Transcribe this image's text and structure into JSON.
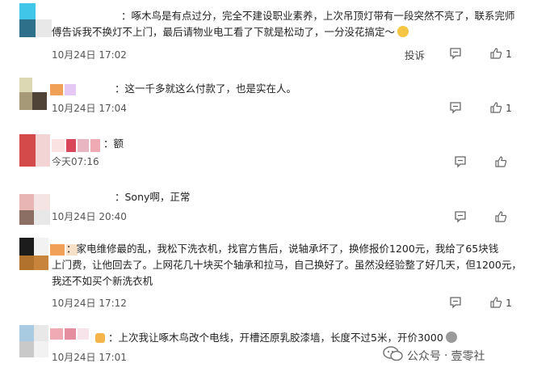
{
  "comments": [
    {
      "lines": [
        "：啄木鸟是有点过分，完全不建设职业素养，上次吊顶灯带有一段突然不亮了，联系完师",
        "傅告诉我不换灯不上门，最后请物业电工看了下就是松动了，一分没花搞定～"
      ],
      "time": "10月24日 17:02",
      "report_label": "投诉",
      "likes": "1"
    },
    {
      "lines": [
        "：这一千多就这么付款了，也是实在人。"
      ],
      "time": "10月24日 17:04",
      "likes": "1"
    },
    {
      "lines": [
        "：额"
      ],
      "time": "今天07:16",
      "likes": ""
    },
    {
      "lines": [
        "：Sony啊，正常"
      ],
      "time": "10月24日 20:40",
      "likes": ""
    },
    {
      "lines": [
        "：家电维修最的乱，我松下洗衣机，找官方售后，说轴承坏了，换修报价1200元，我给了65块钱",
        "上门费，让他回去了。上网花几十块买个轴承和拉马，自己换好了。虽然没经验整了好几天，但1200元，",
        "我还不如买个新洗衣机"
      ],
      "time": "10月24日 17:12",
      "likes": "1"
    },
    {
      "lines": [
        "：上次我让啄木鸟改个电线，开槽还原乳胶漆墙，长度不过5米，开价3000"
      ],
      "time": "10月24日 17:01",
      "likes": ""
    }
  ],
  "watermark": {
    "prefix": "公众号",
    "separator": "·",
    "name": "壹零社"
  },
  "colors": {
    "text": "#222222",
    "meta": "#555555",
    "icon": "#666666"
  },
  "icons": [
    "comment-icon",
    "like-icon",
    "emoji-face-icon",
    "skull-emoji-icon",
    "wechat-logo-icon"
  ]
}
